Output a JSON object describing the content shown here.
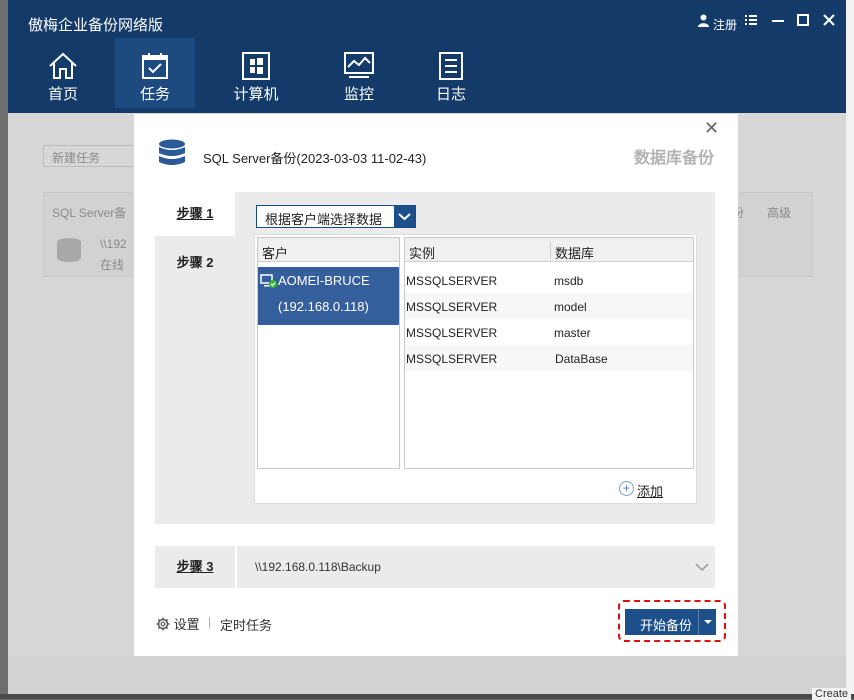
{
  "app": {
    "title": "傲梅企业备份网络版",
    "register": "注册"
  },
  "nav": {
    "items": [
      {
        "label": "首页"
      },
      {
        "label": "任务"
      },
      {
        "label": "计算机"
      },
      {
        "label": "监控"
      },
      {
        "label": "日志"
      }
    ],
    "active_index": 1
  },
  "background": {
    "new_task_placeholder": "新建任务",
    "header_col1": "SQL Server备",
    "header_col2": "份",
    "header_col3": "高级",
    "row_path": "\\\\192",
    "row_status": "在线",
    "create_label": "Create"
  },
  "dialog": {
    "title": "SQL Server备份(2023-03-03 11-02-43)",
    "subtitle": "数据库备份",
    "step1": "步骤 1",
    "step2": "步骤 2",
    "step3": "步骤 3",
    "source_select": "根据客户端选择数据",
    "client_header": "客户",
    "client_name": "AOMEI-BRUCE",
    "client_ip": "(192.168.0.118)",
    "instance_header": "实例",
    "database_header": "数据库",
    "rows": [
      {
        "instance": "MSSQLSERVER",
        "database": "msdb"
      },
      {
        "instance": "MSSQLSERVER",
        "database": "model"
      },
      {
        "instance": "MSSQLSERVER",
        "database": "master"
      },
      {
        "instance": "MSSQLSERVER",
        "database": "DataBase"
      }
    ],
    "add_label": "添加",
    "destination_path": "\\\\192.168.0.118\\Backup",
    "settings_label": "设置",
    "separator": "|",
    "schedule_label": "定时任务",
    "start_label": "开始备份"
  },
  "colors": {
    "header_bg": "#133a68",
    "accent": "#1d4f8a",
    "selection": "#355e9c",
    "highlight_border": "#e01010"
  }
}
